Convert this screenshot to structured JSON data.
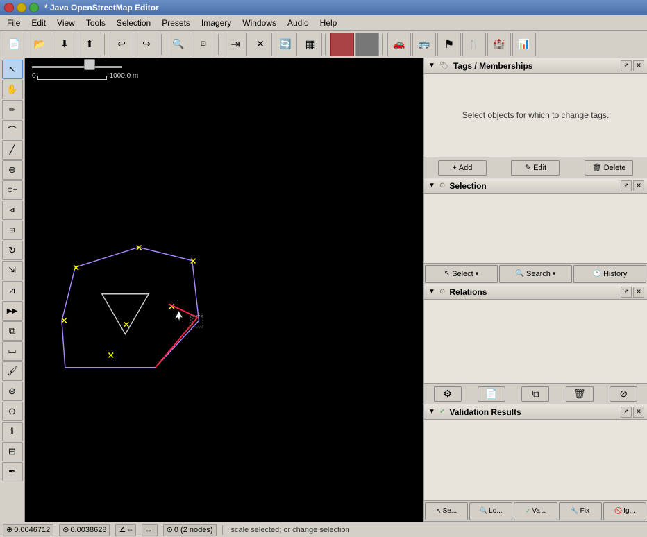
{
  "titlebar": {
    "title": "* Java OpenStreetMap Editor",
    "close_label": "",
    "minimize_label": "",
    "maximize_label": ""
  },
  "menubar": {
    "items": [
      "File",
      "Edit",
      "View",
      "Tools",
      "Selection",
      "Presets",
      "Imagery",
      "Windows",
      "Audio",
      "Help"
    ]
  },
  "toolbar": {
    "buttons": [
      {
        "name": "new-btn",
        "icon": "📄",
        "title": "New"
      },
      {
        "name": "open-btn",
        "icon": "📂",
        "title": "Open"
      },
      {
        "name": "download-btn",
        "icon": "⬇",
        "title": "Download"
      },
      {
        "name": "upload-btn",
        "icon": "⬆",
        "title": "Upload"
      },
      {
        "name": "undo-btn",
        "icon": "↩",
        "title": "Undo"
      },
      {
        "name": "redo-btn",
        "icon": "↪",
        "title": "Redo"
      },
      {
        "name": "zoom-btn",
        "icon": "🔍",
        "title": "Zoom"
      },
      {
        "name": "zoom-native-btn",
        "icon": "⊡",
        "title": "Zoom Native"
      },
      {
        "name": "select-btn",
        "icon": "⇥",
        "title": "Select"
      },
      {
        "name": "node-btn",
        "icon": "✕",
        "title": "Node"
      },
      {
        "name": "refresh-btn",
        "icon": "🔄",
        "title": "Refresh"
      },
      {
        "name": "map1-btn",
        "icon": "▦",
        "title": "Map1"
      },
      {
        "name": "sep1",
        "separator": true
      },
      {
        "name": "car-btn",
        "icon": "🚗",
        "title": "Car"
      },
      {
        "name": "bus-btn",
        "icon": "🚌",
        "title": "Bus"
      },
      {
        "name": "poi1-btn",
        "icon": "⚑",
        "title": "POI1"
      },
      {
        "name": "food-btn",
        "icon": "🍴",
        "title": "Food"
      },
      {
        "name": "castle-btn",
        "icon": "🏰",
        "title": "Castle"
      },
      {
        "name": "chart-btn",
        "icon": "📊",
        "title": "Chart"
      }
    ]
  },
  "left_toolbar": {
    "buttons": [
      {
        "name": "select-tool",
        "icon": "↖",
        "title": "Select",
        "active": true
      },
      {
        "name": "pan-tool",
        "icon": "✋",
        "title": "Pan"
      },
      {
        "name": "draw-tool",
        "icon": "✏",
        "title": "Draw"
      },
      {
        "name": "curve-tool",
        "icon": "⌒",
        "title": "Curve"
      },
      {
        "name": "line-tool",
        "icon": "╱",
        "title": "Line"
      },
      {
        "name": "zoom-tool",
        "icon": "⊕",
        "title": "Zoom"
      },
      {
        "name": "node-tool",
        "icon": "⊙",
        "title": "Node"
      },
      {
        "name": "parallel-tool",
        "icon": "⧏",
        "title": "Parallel"
      },
      {
        "name": "move-tool",
        "icon": "⊞",
        "title": "Move"
      },
      {
        "name": "rotate-tool",
        "icon": "↻",
        "title": "Rotate"
      },
      {
        "name": "scale-tool",
        "icon": "⇲",
        "title": "Scale"
      },
      {
        "name": "extrude-tool",
        "icon": "⊿",
        "title": "Extrude"
      },
      {
        "name": "follow-tool",
        "icon": "▶▶",
        "title": "Follow"
      },
      {
        "name": "layer-tool",
        "icon": "⧉",
        "title": "Layer"
      },
      {
        "name": "area-tool",
        "icon": "▭",
        "title": "Area"
      },
      {
        "name": "paint-tool",
        "icon": "🖌",
        "title": "Paint"
      },
      {
        "name": "spiro-tool",
        "icon": "⊛",
        "title": "Spiro"
      },
      {
        "name": "tag-tool",
        "icon": "⊙",
        "title": "Tag"
      },
      {
        "name": "info-tool",
        "icon": "ℹ",
        "title": "Info"
      },
      {
        "name": "fix-tool",
        "icon": "⊞",
        "title": "Fix"
      },
      {
        "name": "pen-tool",
        "icon": "✒",
        "title": "Pen"
      }
    ]
  },
  "scale": {
    "zero": "0",
    "distance": "1000.0 m"
  },
  "right_panel": {
    "tags_section": {
      "title": "Tags / Memberships",
      "message": "Select objects for which to change tags.",
      "buttons": [
        {
          "name": "add-tag-btn",
          "label": "+ Add"
        },
        {
          "name": "edit-tag-btn",
          "label": "✎ Edit"
        },
        {
          "name": "delete-tag-btn",
          "label": "🗑 Delete"
        }
      ]
    },
    "selection_section": {
      "title": "Selection",
      "buttons": [
        {
          "name": "select-btn",
          "label": "Select",
          "has_dropdown": true
        },
        {
          "name": "search-btn",
          "label": "Search",
          "has_dropdown": true
        },
        {
          "name": "history-btn",
          "label": "History",
          "has_dropdown": false
        }
      ]
    },
    "relations_section": {
      "title": "Relations",
      "buttons": [
        {
          "name": "rel-add-btn",
          "icon": "⚙"
        },
        {
          "name": "rel-new-btn",
          "icon": "📄"
        },
        {
          "name": "rel-copy-btn",
          "icon": "⧉"
        },
        {
          "name": "rel-del-btn",
          "icon": "🗑"
        },
        {
          "name": "rel-extra-btn",
          "icon": "⊘"
        }
      ]
    },
    "validation_section": {
      "title": "Validation Results",
      "buttons": [
        {
          "name": "val-se-btn",
          "label": "Se..."
        },
        {
          "name": "val-lo-btn",
          "label": "Lo..."
        },
        {
          "name": "val-va-btn",
          "label": "✓ Va..."
        },
        {
          "name": "val-fix-btn",
          "label": "Fix"
        },
        {
          "name": "val-ig-btn",
          "label": "Ig..."
        }
      ]
    }
  },
  "statusbar": {
    "coord1_icon": "⊕",
    "coord1": "0.0046712",
    "coord2_icon": "⊙",
    "coord2": "0.0038628",
    "angle_icon": "∠",
    "angle": "--",
    "dist_icon": "↔",
    "dist": "",
    "nodes_icon": "⊙",
    "nodes": "0 (2 nodes)",
    "message": "scale selected; or change selection"
  }
}
